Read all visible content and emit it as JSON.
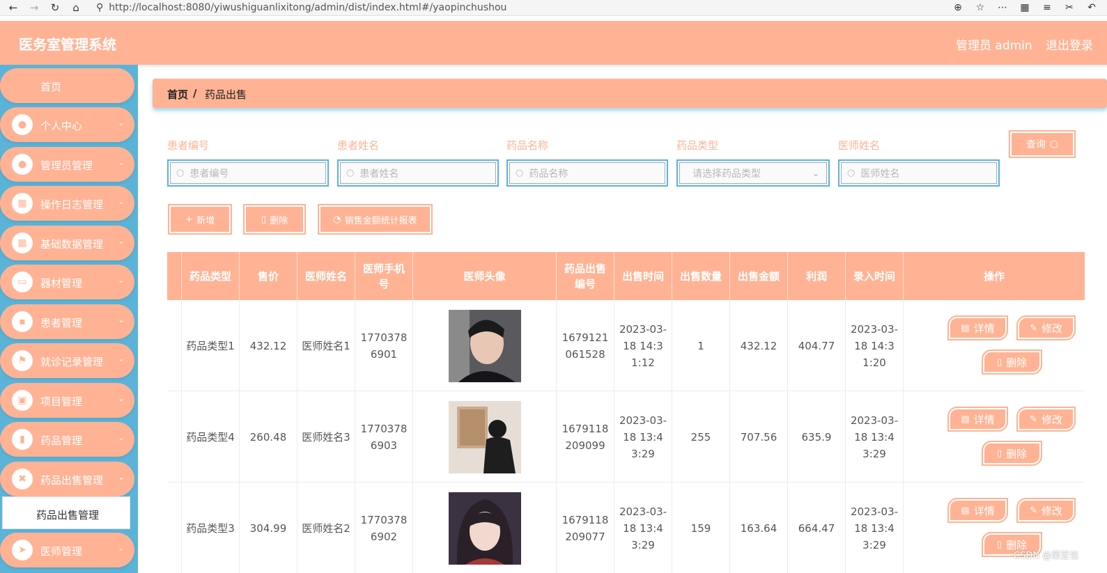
{
  "browser": {
    "url": "http://localhost:8080/yiwushiguanlixitong/admin/dist/index.html#/yaopinchushou"
  },
  "header": {
    "title": "医务室管理系统",
    "admin_label": "管理员 admin",
    "logout_label": "退出登录"
  },
  "sidebar": {
    "home": "首页",
    "items": [
      {
        "label": "个人中心",
        "icon": "user-icon"
      },
      {
        "label": "管理员管理",
        "icon": "user-icon"
      },
      {
        "label": "操作日志管理",
        "icon": "grid-icon"
      },
      {
        "label": "基础数据管理",
        "icon": "grid-icon"
      },
      {
        "label": "器材管理",
        "icon": "monitor-icon"
      },
      {
        "label": "患者管理",
        "icon": "chat-icon"
      },
      {
        "label": "就诊记录管理",
        "icon": "flag-icon"
      },
      {
        "label": "项目管理",
        "icon": "clipboard-icon"
      },
      {
        "label": "药品管理",
        "icon": "bar-chart-icon"
      },
      {
        "label": "药品出售管理",
        "icon": "ticket-icon"
      },
      {
        "label": "医师管理",
        "icon": "send-icon"
      }
    ],
    "active_sub": "药品出售管理"
  },
  "breadcrumb": {
    "home": "首页",
    "separator": "/",
    "current": "药品出售"
  },
  "filters": [
    {
      "label": "患者编号",
      "placeholder": "患者编号"
    },
    {
      "label": "患者姓名",
      "placeholder": "患者姓名"
    },
    {
      "label": "药品名称",
      "placeholder": "药品名称"
    },
    {
      "label": "药品类型",
      "placeholder": "请选择药品类型"
    },
    {
      "label": "医师姓名",
      "placeholder": "医师姓名"
    }
  ],
  "query_button": "查询",
  "actions": {
    "add": "新增",
    "delete": "删除",
    "report": "销售金额统计报表"
  },
  "table": {
    "headers": [
      "药品类型",
      "售价",
      "医师姓名",
      "医师手机号",
      "医师头像",
      "药品出售编号",
      "出售时间",
      "出售数量",
      "出售金额",
      "利润",
      "录入时间",
      "操作"
    ],
    "rows": [
      {
        "type": "药品类型1",
        "price": "432.12",
        "doctor": "医师姓名1",
        "phone": "17703786901",
        "sale_no": "1679121061528",
        "sale_time": "2023-03-18 14:31:12",
        "qty": "1",
        "amount": "432.12",
        "profit": "404.77",
        "entry_time": "2023-03-18 14:31:20"
      },
      {
        "type": "药品类型4",
        "price": "260.48",
        "doctor": "医师姓名3",
        "phone": "17703786903",
        "sale_no": "1679118209099",
        "sale_time": "2023-03-18 13:43:29",
        "qty": "255",
        "amount": "707.56",
        "profit": "635.9",
        "entry_time": "2023-03-18 13:43:29"
      },
      {
        "type": "药品类型3",
        "price": "304.99",
        "doctor": "医师姓名2",
        "phone": "17703786902",
        "sale_no": "1679118209077",
        "sale_time": "2023-03-18 13:43:29",
        "qty": "159",
        "amount": "163.64",
        "profit": "664.47",
        "entry_time": "2023-03-18 13:43:29"
      }
    ],
    "op_detail": "详情",
    "op_edit": "修改",
    "op_delete": "删除"
  },
  "watermark": "CSDN @栗豆包",
  "colors": {
    "primary": "#ffb394",
    "sidebar_bg": "#5bb3d8"
  }
}
